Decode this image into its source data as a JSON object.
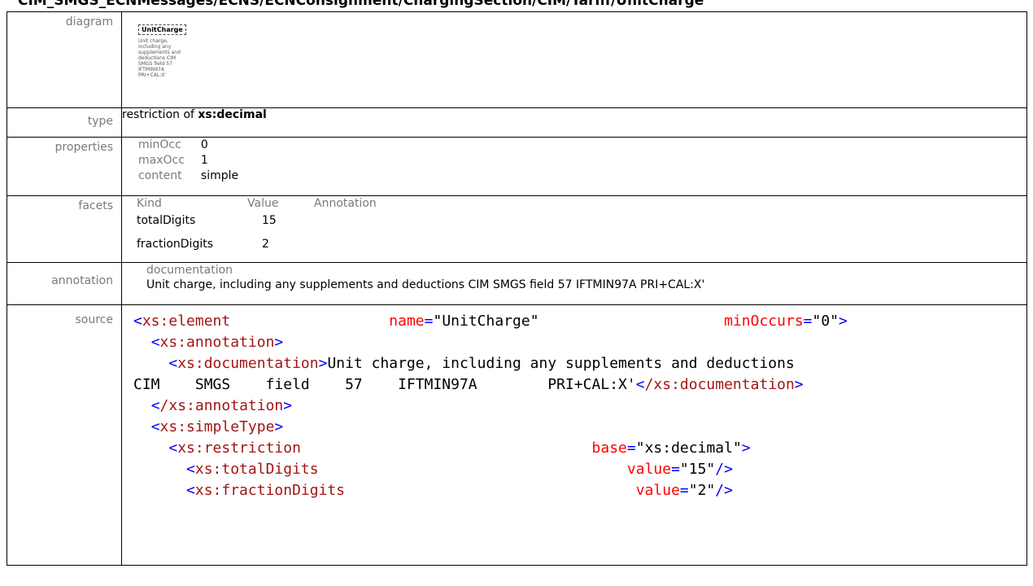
{
  "title": "CIM_SMGS_ECNMessages/ECNS/ECNConsignment/ChargingSection/CIM/Tariff/UnitCharge",
  "labels": {
    "diagram": "diagram",
    "type": "type",
    "properties": "properties",
    "facets": "facets",
    "annotation": "annotation",
    "source": "source"
  },
  "diagram": {
    "element_name": "UnitCharge",
    "description": "Unit charge,\nincluding any\nsupplements and\ndeductions CIM\nSMGS field 57\nIFTMIN97A\nPRI+CAL:X'"
  },
  "type": {
    "prefix": "restriction of ",
    "base": "xs:decimal"
  },
  "properties": [
    {
      "key": "minOcc",
      "value": "0"
    },
    {
      "key": "maxOcc",
      "value": "1"
    },
    {
      "key": "content",
      "value": "simple"
    }
  ],
  "facets": {
    "headers": {
      "kind": "Kind",
      "value": "Value",
      "annotation": "Annotation"
    },
    "rows": [
      {
        "kind": "totalDigits",
        "value": "15"
      },
      {
        "kind": "fractionDigits",
        "value": "2"
      }
    ]
  },
  "annotation": {
    "label": "documentation",
    "text": "Unit charge, including any supplements and deductions CIM SMGS field 57 IFTMIN97A  PRI+CAL:X'"
  },
  "source": {
    "l1_tag": "xs:element",
    "l1_attr1": "name",
    "l1_val1": "\"UnitCharge\"",
    "l1_attr2": "minOccurs",
    "l1_val2": "\"0\"",
    "l2_tag": "xs:annotation",
    "l3_tag": "xs:documentation",
    "l3_text": "Unit charge, including any supplements and deductions",
    "l4_text": "CIM    SMGS    field    57    IFTMIN97A        PRI+CAL:X'",
    "l4_close": "/xs:documentation",
    "l5_close": "/xs:annotation",
    "l6_tag": "xs:simpleType",
    "l7_tag": "xs:restriction",
    "l7_attr": "base",
    "l7_val": "\"xs:decimal\"",
    "l8_tag": "xs:totalDigits",
    "l8_attr": "value",
    "l8_val": "\"15\"",
    "l9_tag": "xs:fractionDigits",
    "l9_attr": "value",
    "l9_val": "\"2\""
  }
}
